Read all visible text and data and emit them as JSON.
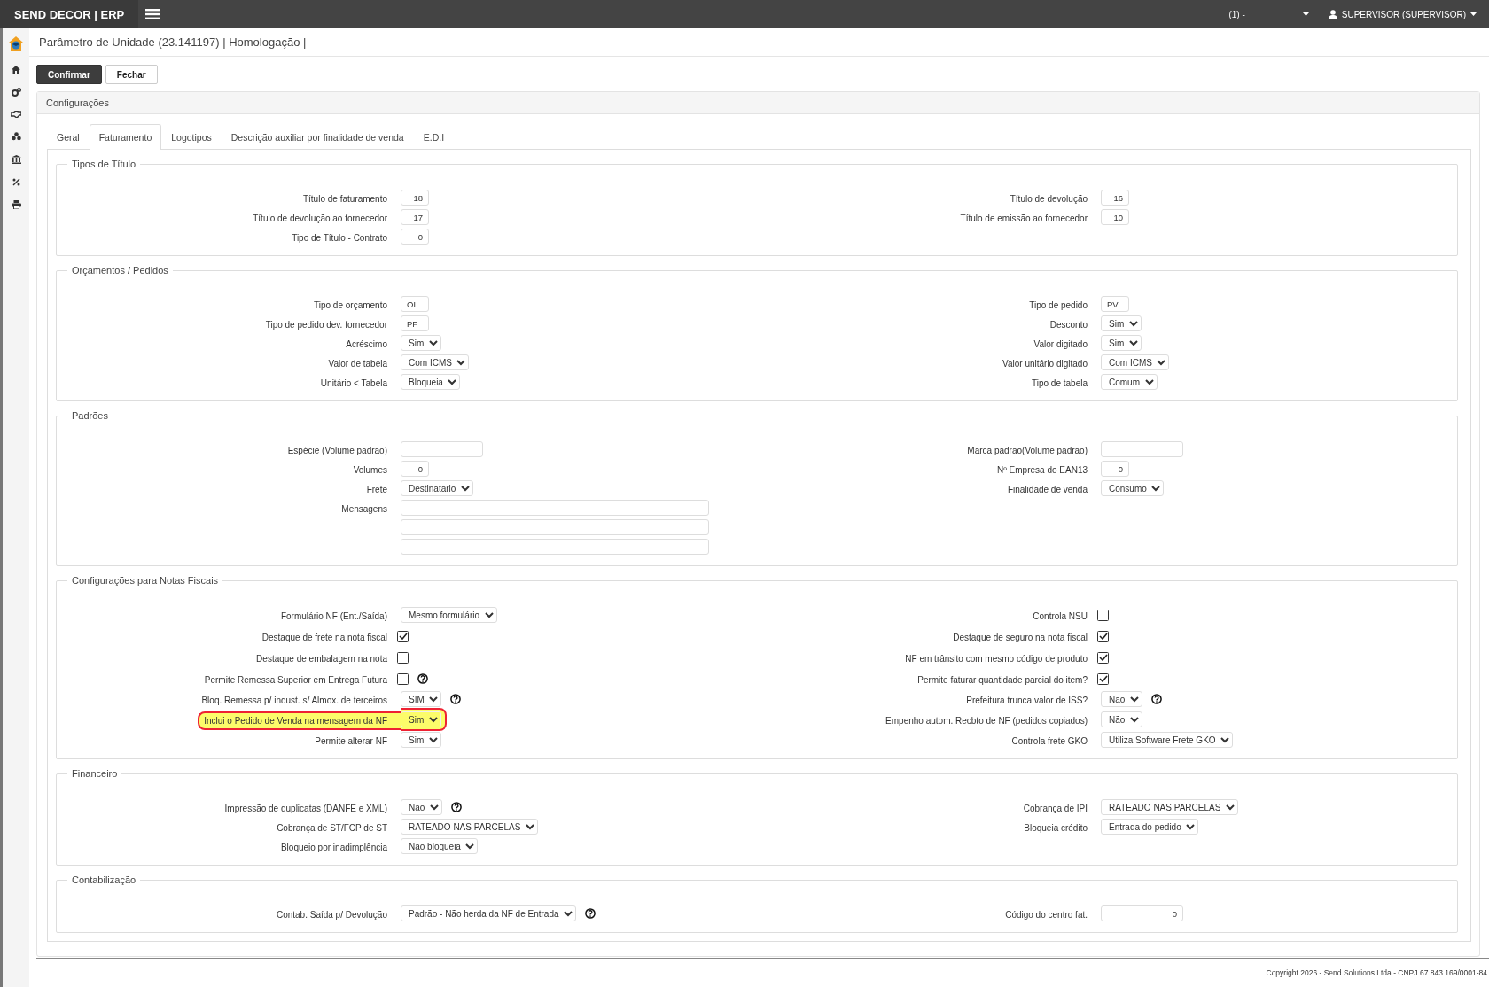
{
  "topbar": {
    "brand": "SEND DECOR | ERP",
    "unit": "(1) -",
    "user": "SUPERVISOR (SUPERVISOR)"
  },
  "page_title": "Parâmetro de Unidade (23.141197) | Homologação |",
  "buttons": [
    {
      "label": "Confirmar",
      "kind": "primary"
    },
    {
      "label": "Fechar",
      "kind": "default"
    }
  ],
  "panel_title": "Configurações",
  "tabs": [
    {
      "label": "Geral",
      "selected": false
    },
    {
      "label": "Faturamento",
      "selected": true
    },
    {
      "label": "Logotipos",
      "selected": false
    },
    {
      "label": "Descrição auxiliar por finalidade de venda",
      "selected": false
    },
    {
      "label": "E.D.I",
      "selected": false
    }
  ],
  "sections": [
    {
      "title": "Tipos de Título",
      "rows": [
        {
          "left": {
            "label": "Título de faturamento",
            "kind": "number",
            "value": "18"
          },
          "right": {
            "label": "Título de devolução",
            "kind": "number",
            "value": "16"
          }
        },
        {
          "left": {
            "label": "Título de devolução ao fornecedor",
            "kind": "number",
            "value": "17"
          },
          "right": {
            "label": "Título de emissão ao fornecedor",
            "kind": "number",
            "value": "10"
          }
        },
        {
          "left": {
            "label": "Tipo de Título - Contrato",
            "kind": "number",
            "value": "0"
          }
        }
      ]
    },
    {
      "title": "Orçamentos / Pedidos",
      "rows": [
        {
          "left": {
            "label": "Tipo de orçamento",
            "kind": "code",
            "value": "OL"
          },
          "right": {
            "label": "Tipo de pedido",
            "kind": "code",
            "value": "PV"
          }
        },
        {
          "left": {
            "label": "Tipo de pedido dev. fornecedor",
            "kind": "code",
            "value": "PF"
          },
          "right": {
            "label": "Desconto",
            "kind": "select",
            "value": "Sim"
          }
        },
        {
          "left": {
            "label": "Acréscimo",
            "kind": "select",
            "value": "Sim"
          },
          "right": {
            "label": "Valor digitado",
            "kind": "select",
            "value": "Sim"
          }
        },
        {
          "left": {
            "label": "Valor de tabela",
            "kind": "select",
            "value": "Com ICMS"
          },
          "right": {
            "label": "Valor unitário digitado",
            "kind": "select",
            "value": "Com ICMS"
          }
        },
        {
          "left": {
            "label": "Unitário < Tabela",
            "kind": "select",
            "value": "Bloqueia"
          },
          "right": {
            "label": "Tipo de tabela",
            "kind": "select",
            "value": "Comum"
          }
        }
      ]
    },
    {
      "title": "Padrões",
      "rows": [
        {
          "left": {
            "label": "Espécie (Volume padrão)",
            "kind": "text"
          },
          "right": {
            "label": "Marca padrão(Volume padrão)",
            "kind": "text"
          }
        },
        {
          "left": {
            "label": "Volumes",
            "kind": "number",
            "value": "0"
          },
          "right": {
            "label": "Nº Empresa do EAN13",
            "kind": "number",
            "value": "0"
          }
        },
        {
          "left": {
            "label": "Frete",
            "kind": "select",
            "value": "Destinatario"
          },
          "right": {
            "label": "Finalidade de venda",
            "kind": "select",
            "value": "Consumo"
          }
        },
        {
          "left": {
            "label": "Mensagens",
            "kind": "text-wide"
          }
        },
        {
          "left": {
            "kind": "text-wide"
          }
        },
        {
          "left": {
            "kind": "text-wide"
          }
        }
      ]
    },
    {
      "title": "Configurações para Notas Fiscais",
      "rows": [
        {
          "left": {
            "label": "Formulário NF (Ent./Saída)",
            "kind": "select",
            "value": "Mesmo formulário"
          },
          "right": {
            "label": "Controla NSU",
            "kind": "checkbox",
            "checked": false
          }
        },
        {
          "left": {
            "label": "Destaque de frete na nota fiscal",
            "kind": "checkbox",
            "checked": true
          },
          "right": {
            "label": "Destaque de seguro na nota fiscal",
            "kind": "checkbox",
            "checked": true
          }
        },
        {
          "left": {
            "label": "Destaque de embalagem na nota",
            "kind": "checkbox",
            "checked": false
          },
          "right": {
            "label": "NF em trânsito com mesmo código de produto",
            "kind": "checkbox",
            "checked": true
          }
        },
        {
          "left": {
            "label": "Permite Remessa Superior em Entrega Futura",
            "kind": "checkbox",
            "checked": false,
            "help": true
          },
          "right": {
            "label": "Permite faturar quantidade parcial do item?",
            "kind": "checkbox",
            "checked": true
          }
        },
        {
          "left": {
            "label": "Bloq. Remessa p/ indust. s/ Almox. de terceiros",
            "kind": "select",
            "value": "SIM",
            "help": true
          },
          "right": {
            "label": "Prefeitura trunca valor de ISS?",
            "kind": "select",
            "value": "Não",
            "help": true
          }
        },
        {
          "left": {
            "label": "Inclui o Pedido de Venda na mensagem da NF",
            "kind": "select",
            "value": "Sim",
            "highlighted": true
          },
          "right": {
            "label": "Empenho autom. Recbto de NF (pedidos copiados)",
            "kind": "select",
            "value": "Não"
          }
        },
        {
          "left": {
            "label": "Permite alterar NF",
            "kind": "select",
            "value": "Sim"
          },
          "right": {
            "label": "Controla frete GKO",
            "kind": "select",
            "value": "Utiliza Software Frete GKO"
          }
        }
      ]
    },
    {
      "title": "Financeiro",
      "rows": [
        {
          "left": {
            "label": "Impressão de duplicatas (DANFE e XML)",
            "kind": "select",
            "value": "Não",
            "help": true
          },
          "right": {
            "label": "Cobrança de IPI",
            "kind": "select",
            "value": "RATEADO NAS PARCELAS"
          }
        },
        {
          "left": {
            "label": "Cobrança de ST/FCP de ST",
            "kind": "select",
            "value": "RATEADO NAS PARCELAS"
          },
          "right": {
            "label": "Bloqueia crédito",
            "kind": "select",
            "value": "Entrada do pedido"
          }
        },
        {
          "left": {
            "label": "Bloqueio por inadimplência",
            "kind": "select",
            "value": "Não bloqueia"
          }
        }
      ]
    },
    {
      "title": "Contabilização",
      "rows": [
        {
          "left": {
            "label": "Contab. Saída p/ Devolução",
            "kind": "select",
            "value": "Padrão - Não herda da NF de Entrada",
            "help": true
          },
          "right": {
            "label": "Código do centro fat.",
            "kind": "amount",
            "value": "0"
          }
        }
      ]
    }
  ],
  "footer": "Copyright 2026 - Send Solutions Ltda - CNPJ 67.843.169/0001-84"
}
